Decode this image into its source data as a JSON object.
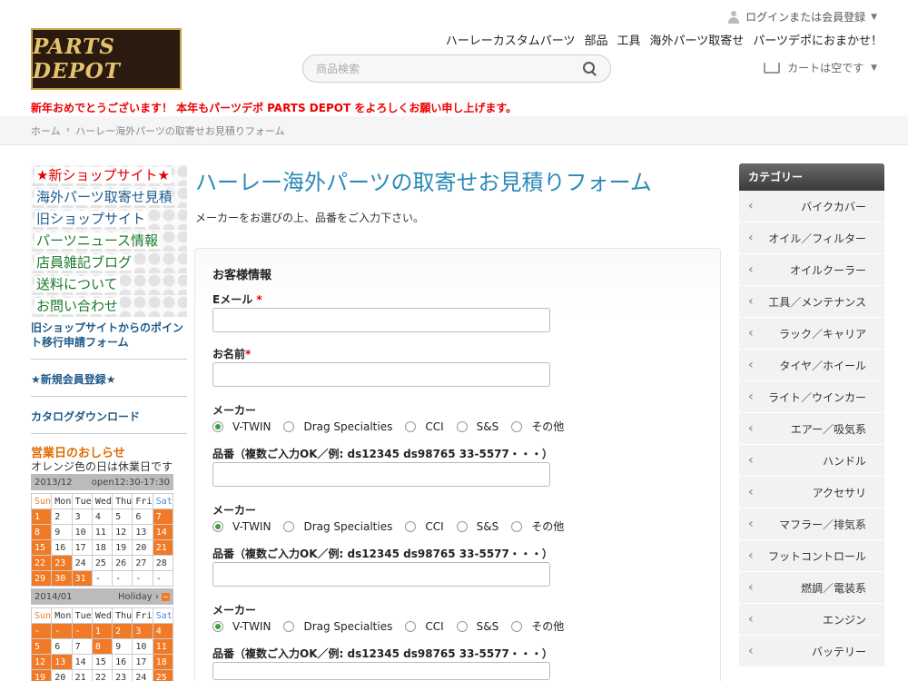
{
  "header": {
    "logo_text": "PARTS DEPOT",
    "login_label": "ログインまたは会員登録",
    "nav": [
      "ハーレーカスタムパーツ",
      "部品",
      "工具",
      "海外パーツ取寄せ",
      "パーツデポにおまかせ！"
    ],
    "search_placeholder": "商品検索",
    "cart_label": "カートは空です",
    "notice": "新年おめでとうございます！ 本年もパーツデポ PARTS DEPOT をよろしくお願い申し上げます。"
  },
  "breadcrumb": [
    "ホーム",
    "ハーレー海外パーツの取寄せお見積りフォーム"
  ],
  "left": {
    "pattern_items": [
      {
        "label": "★新ショップサイト★",
        "style": "red"
      },
      {
        "label": "海外パーツ取寄せ見積り",
        "style": "blue"
      },
      {
        "label": "旧ショップサイト",
        "style": "blue"
      },
      {
        "label": "パーツニュース情報",
        "style": "green"
      },
      {
        "label": "店員雑記ブログ",
        "style": "green"
      },
      {
        "label": "送料について",
        "style": "green"
      },
      {
        "label": "お問い合わせ",
        "style": "green"
      }
    ],
    "point_link": "旧ショップサイトからのポイント移行申請フォーム",
    "register_link": "★新規会員登録★",
    "catalog_link": "カタログダウンロード",
    "eigyo_title": "営業日のおしらせ",
    "eigyo_desc": "オレンジ色の日は休業日です",
    "cal1": {
      "month": "2013/12",
      "hours": "open12:30-17:30",
      "weekdays": [
        "Sun",
        "Mon",
        "Tue",
        "Wed",
        "Thu",
        "Fri",
        "Sat"
      ],
      "rows": [
        [
          "1",
          "2",
          "3",
          "4",
          "5",
          "6",
          "7"
        ],
        [
          "8",
          "9",
          "10",
          "11",
          "12",
          "13",
          "14"
        ],
        [
          "15",
          "16",
          "17",
          "18",
          "19",
          "20",
          "21"
        ],
        [
          "22",
          "23",
          "24",
          "25",
          "26",
          "27",
          "28"
        ],
        [
          "29",
          "30",
          "31",
          "-",
          "-",
          "-",
          "-"
        ]
      ],
      "holidays": [
        [
          0,
          0
        ],
        [
          0,
          6
        ],
        [
          1,
          0
        ],
        [
          1,
          6
        ],
        [
          2,
          0
        ],
        [
          2,
          6
        ],
        [
          3,
          0
        ],
        [
          3,
          1
        ],
        [
          4,
          0
        ],
        [
          4,
          1
        ],
        [
          4,
          2
        ]
      ]
    },
    "cal2": {
      "month": "2014/01",
      "nav_label": "Holiday",
      "weekdays": [
        "Sun",
        "Mon",
        "Tue",
        "Wed",
        "Thu",
        "Fri",
        "Sat"
      ],
      "rows": [
        [
          "-",
          "-",
          "-",
          "1",
          "2",
          "3",
          "4"
        ],
        [
          "5",
          "6",
          "7",
          "8",
          "9",
          "10",
          "11"
        ],
        [
          "12",
          "13",
          "14",
          "15",
          "16",
          "17",
          "18"
        ],
        [
          "19",
          "20",
          "21",
          "22",
          "23",
          "24",
          "25"
        ]
      ],
      "holidays": [
        [
          0,
          0
        ],
        [
          0,
          1
        ],
        [
          0,
          2
        ],
        [
          0,
          3
        ],
        [
          0,
          4
        ],
        [
          0,
          5
        ],
        [
          0,
          6
        ],
        [
          1,
          0
        ],
        [
          1,
          3
        ],
        [
          1,
          6
        ],
        [
          2,
          0
        ],
        [
          2,
          1
        ],
        [
          2,
          6
        ],
        [
          3,
          0
        ],
        [
          3,
          6
        ]
      ]
    }
  },
  "main": {
    "title": "ハーレー海外パーツの取寄せお見積りフォーム",
    "subtitle": "メーカーをお選びの上、品番をご入力下さい。",
    "section_title": "お客様情報",
    "email_label": "Eメール",
    "name_label": "お名前",
    "maker_label": "メーカー",
    "part_label": "品番（複数ご入力OK／例: ds12345 ds98765 33-5577・・・）",
    "maker_options": [
      "V-TWIN",
      "Drag Specialties",
      "CCI",
      "S&S",
      "その他"
    ],
    "selected_maker": "V-TWIN"
  },
  "categories": {
    "title": "カテゴリー",
    "items": [
      "バイクカバー",
      "オイル／フィルター",
      "オイルクーラー",
      "工具／メンテナンス",
      "ラック／キャリア",
      "タイヤ／ホイール",
      "ライト／ウインカー",
      "エアー／吸気系",
      "ハンドル",
      "アクセサリ",
      "マフラー／排気系",
      "フットコントロール",
      "燃調／電装系",
      "エンジン",
      "バッテリー"
    ]
  },
  "colors": {
    "accent": "#2a8ab8",
    "holiday": "#f07a25",
    "notice": "#e00000"
  }
}
